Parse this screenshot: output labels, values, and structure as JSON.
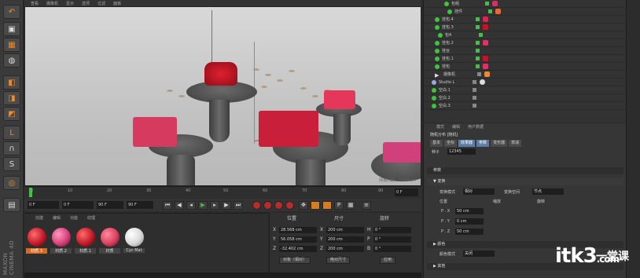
{
  "viewport_menu": [
    "查看",
    "摄像机",
    "显示",
    "选项",
    "过滤",
    "面板"
  ],
  "viewport_labels": {
    "grid_spacing": "网格间距：1000 cm"
  },
  "left_tools": [
    "cube-icon",
    "checker-icon",
    "sphere-icon",
    "cube2-icon",
    "cylinder-icon",
    "L-icon",
    "magnet-icon",
    "S-icon",
    "orbit-icon",
    "grid-icon"
  ],
  "brand": "MAXON CINEMA 4D",
  "timeline": {
    "ticks": [
      "0",
      "10",
      "20",
      "30",
      "40",
      "50",
      "60",
      "70",
      "80",
      "90"
    ],
    "frame_field": "0 F"
  },
  "transport": {
    "start": "0 F",
    "current": "0 F",
    "end": "90 F",
    "end2": "90 F"
  },
  "materials": {
    "menu": [
      "创建",
      "编辑",
      "功能",
      "纹理"
    ],
    "items": [
      {
        "label": "材质.3",
        "color": "#c21a2a",
        "selected": true
      },
      {
        "label": "材质.2",
        "color": "#d6407a",
        "selected": false
      },
      {
        "label": "材质.1",
        "color": "#c21a2a",
        "selected": false
      },
      {
        "label": "材质",
        "color": "#d8405f",
        "selected": false
      },
      {
        "label": "Cyc Mat",
        "color": "#e6e6e6",
        "selected": false
      }
    ]
  },
  "coordinates": {
    "headers": [
      "位置",
      "尺寸",
      "旋转"
    ],
    "rows": [
      {
        "axis": "X",
        "pos": "28.568 cm",
        "size_axis": "X",
        "size": "200 cm",
        "rot_axis": "H",
        "rot": "0 °"
      },
      {
        "axis": "Y",
        "pos": "56.058 cm",
        "size_axis": "Y",
        "size": "200 cm",
        "rot_axis": "P",
        "rot": "0 °"
      },
      {
        "axis": "Z",
        "pos": "-32.402 cm",
        "size_axis": "Z",
        "size": "200 cm",
        "rot_axis": "B",
        "rot": "0 °"
      }
    ],
    "mode": "对象（相对）",
    "size_mode": "绝对尺寸",
    "apply": "应用"
  },
  "objects": [
    {
      "name": "包组",
      "icon": "null"
    },
    {
      "name": "挂件",
      "icon": "null"
    },
    {
      "name": "挂包.4",
      "icon": "null"
    },
    {
      "name": "挂包.3",
      "icon": "null"
    },
    {
      "name": "包4",
      "icon": "null"
    },
    {
      "name": "挂包.2",
      "icon": "null"
    },
    {
      "name": "挂台",
      "icon": "null"
    },
    {
      "name": "挂包.1",
      "icon": "null"
    },
    {
      "name": "挂包",
      "icon": "null"
    },
    {
      "name": "摄像机",
      "icon": "camera"
    },
    {
      "name": "Studio L",
      "icon": "null"
    },
    {
      "name": "空白.1",
      "icon": "null"
    },
    {
      "name": "空白.2",
      "icon": "null"
    },
    {
      "name": "空白.3",
      "icon": "null"
    }
  ],
  "attributes": {
    "menu": [
      "模式",
      "编辑",
      "用户数据"
    ],
    "title": "随机分布 [随机]",
    "tabs": [
      "基本",
      "坐标",
      "效果器",
      "参数",
      "变形器",
      "衰减"
    ],
    "seed_label": "种子",
    "seed_value": "12345",
    "section_params": "参数",
    "section_transform": "▼ 变换",
    "transform_mode_label": "变换模式",
    "transform_mode": "相对",
    "transform_space_label": "变换空间",
    "transform_space": "节点",
    "pos_label": "位置",
    "scale_label": "缩放",
    "rot_label": "旋转",
    "px": "50 cm",
    "py": "0 cm",
    "pz": "50 cm",
    "section_color": "▶ 颜色",
    "color_mode_label": "颜色模式",
    "color_mode": "关闭",
    "section_other": "▶ 其他"
  },
  "watermark": {
    "text": "itk3",
    "suffix": ".com",
    "cn": "一堂课"
  }
}
